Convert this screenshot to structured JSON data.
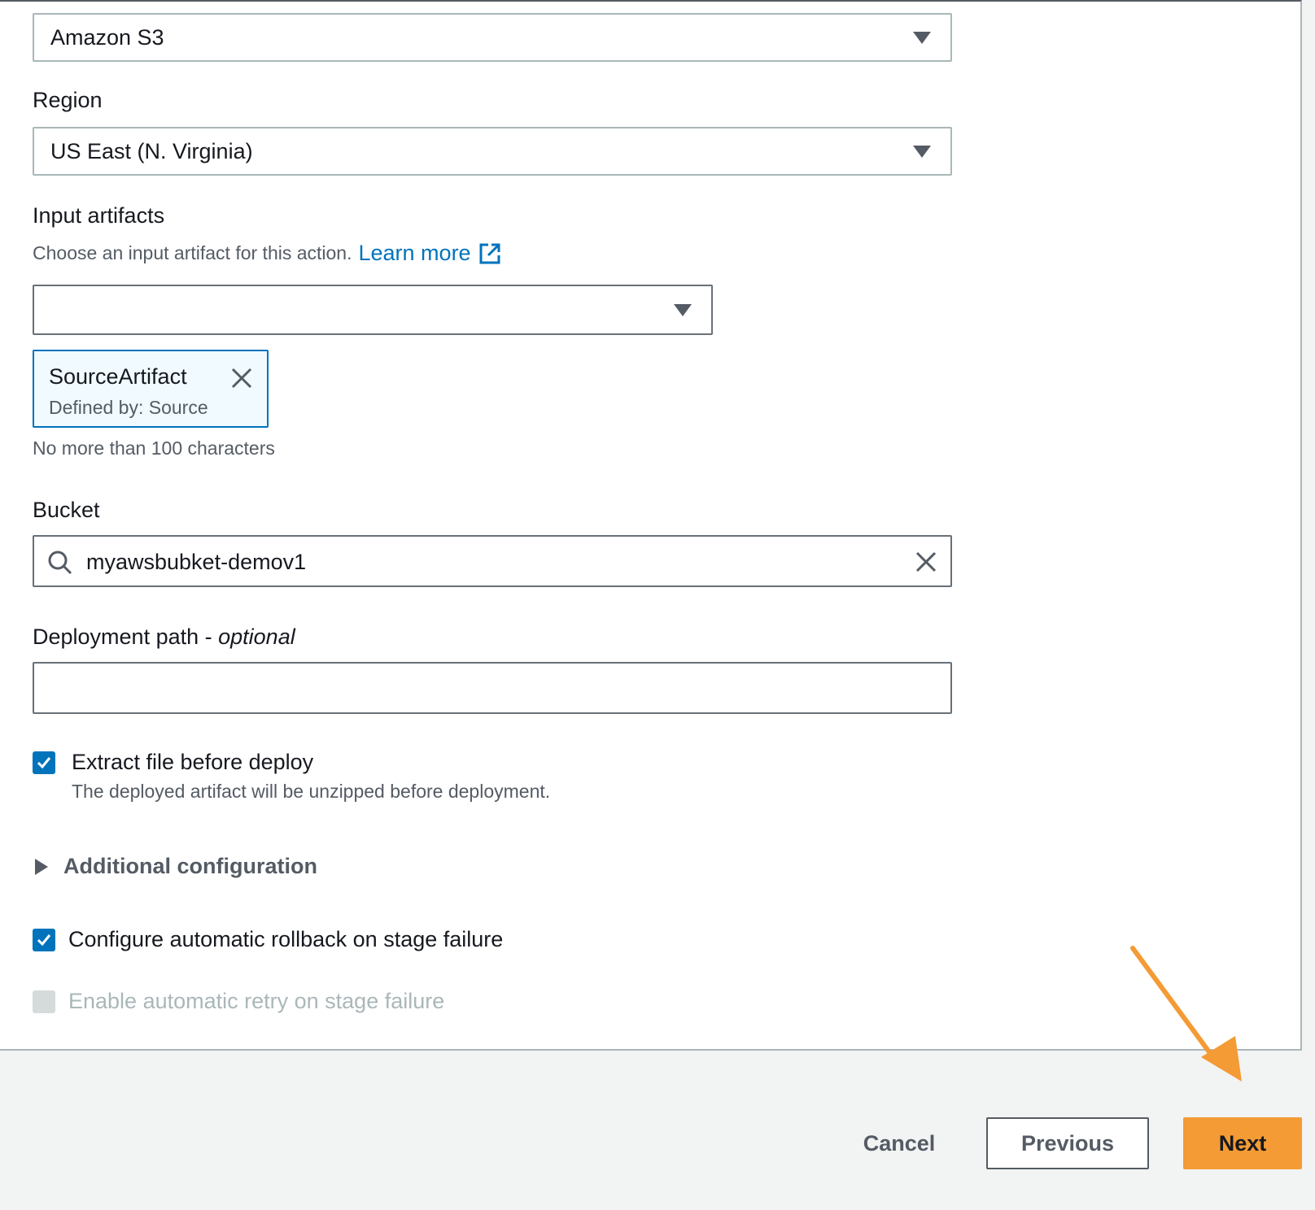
{
  "provider": {
    "value": "Amazon S3"
  },
  "region": {
    "label": "Region",
    "value": "US East (N. Virginia)"
  },
  "input_artifacts": {
    "label": "Input artifacts",
    "description": "Choose an input artifact for this action.",
    "learn_more": "Learn more",
    "select_value": "",
    "token": {
      "name": "SourceArtifact",
      "defined_by": "Defined by: Source"
    },
    "constraint": "No more than 100 characters"
  },
  "bucket": {
    "label": "Bucket",
    "value": "myawsbubket-demov1"
  },
  "deployment_path": {
    "label": "Deployment path - ",
    "optional": "optional",
    "value": ""
  },
  "extract": {
    "label": "Extract file before deploy",
    "description": "The deployed artifact will be unzipped before deployment.",
    "checked": true
  },
  "additional_config": {
    "label": "Additional configuration"
  },
  "rollback": {
    "label": "Configure automatic rollback on stage failure",
    "checked": true
  },
  "retry": {
    "label": "Enable automatic retry on stage failure",
    "checked": false,
    "disabled": true
  },
  "footer": {
    "cancel": "Cancel",
    "previous": "Previous",
    "next": "Next"
  },
  "colors": {
    "primary": "#f49b35",
    "link": "#0073bb",
    "annotation_arrow": "#f49b35"
  }
}
